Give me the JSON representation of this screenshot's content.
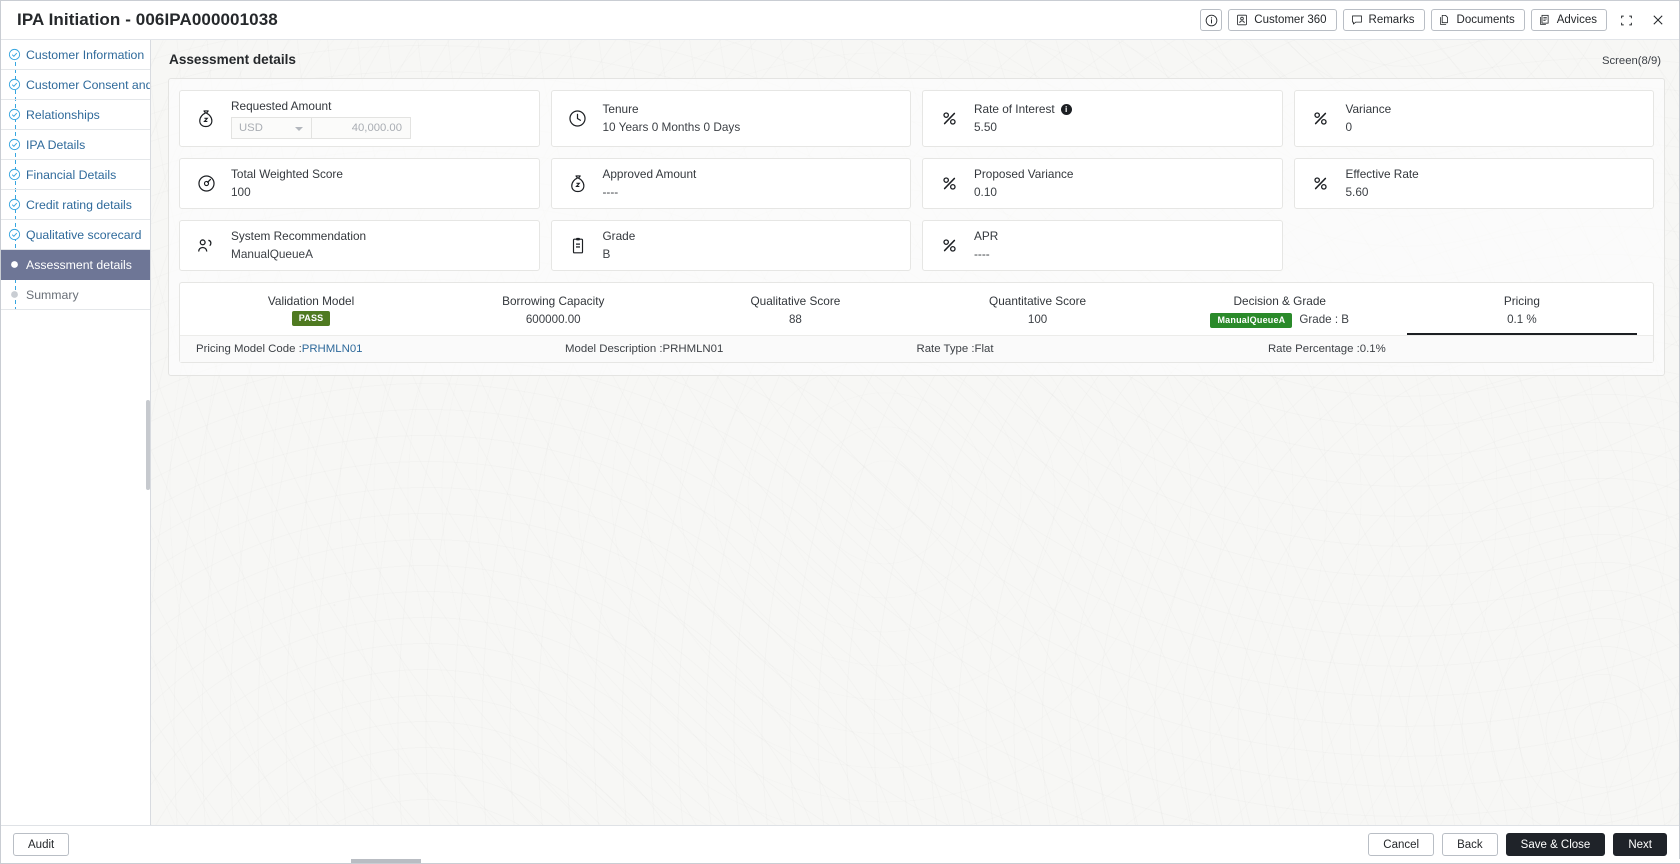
{
  "titlebar": {
    "title": "IPA Initiation - 006IPA000001038",
    "info_icon": "info-circle-icon",
    "buttons": [
      {
        "label": "Customer 360",
        "icon": "user-card-icon"
      },
      {
        "label": "Remarks",
        "icon": "speech-bubble-icon"
      },
      {
        "label": "Documents",
        "icon": "documents-icon"
      },
      {
        "label": "Advices",
        "icon": "advice-document-icon"
      }
    ],
    "minimize_icon": "collapse-icon",
    "close_icon": "close-icon"
  },
  "sidebar": {
    "items": [
      {
        "label": "Customer Information",
        "state": "done"
      },
      {
        "label": "Customer Consent and",
        "state": "done",
        "truncated": "..."
      },
      {
        "label": "Relationships",
        "state": "done"
      },
      {
        "label": "IPA Details",
        "state": "done"
      },
      {
        "label": "Financial Details",
        "state": "done"
      },
      {
        "label": "Credit rating details",
        "state": "done"
      },
      {
        "label": "Qualitative scorecard",
        "state": "done"
      },
      {
        "label": "Assessment details",
        "state": "active"
      },
      {
        "label": "Summary",
        "state": "pending"
      }
    ]
  },
  "main": {
    "section_title": "Assessment details",
    "screen_count": "Screen(8/9)",
    "cards": [
      {
        "label": "Requested Amount",
        "icon": "money-bag-icon",
        "type": "amount",
        "currency": "USD",
        "amount": "40,000.00"
      },
      {
        "label": "Tenure",
        "icon": "clock-icon",
        "value": "10 Years 0 Months 0 Days"
      },
      {
        "label": "Rate of Interest",
        "icon": "percent-icon",
        "value": "5.50",
        "info": "i"
      },
      {
        "label": "Variance",
        "icon": "percent-icon",
        "value": "0"
      },
      {
        "label": "Total Weighted Score",
        "icon": "gauge-icon",
        "value": "100"
      },
      {
        "label": "Approved Amount",
        "icon": "money-bag-icon",
        "value": "----"
      },
      {
        "label": "Proposed Variance",
        "icon": "percent-icon",
        "value": "0.10"
      },
      {
        "label": "Effective Rate",
        "icon": "percent-icon",
        "value": "5.60"
      },
      {
        "label": "System Recommendation",
        "icon": "users-icon",
        "value": "ManualQueueA"
      },
      {
        "label": "Grade",
        "icon": "clipboard-icon",
        "value": "B"
      },
      {
        "label": "APR",
        "icon": "percent-icon",
        "value": "----"
      }
    ],
    "summary": {
      "columns": [
        {
          "head": "Validation Model",
          "badge": "PASS",
          "value": ""
        },
        {
          "head": "Borrowing Capacity",
          "value": "600000.00"
        },
        {
          "head": "Qualitative Score",
          "value": "88"
        },
        {
          "head": "Quantitative Score",
          "value": "100"
        },
        {
          "head": "Decision & Grade",
          "badge": "ManualQueueA",
          "value": "Grade : B"
        },
        {
          "head": "Pricing",
          "value": "0.1 %",
          "selected": true
        }
      ],
      "details": [
        "Pricing Model Code :",
        "PRHMLN01",
        "Model Description :PRHMLN01",
        "Rate Type :Flat",
        "Rate Percentage :0.1%"
      ]
    }
  },
  "footer": {
    "audit": "Audit",
    "cancel": "Cancel",
    "back": "Back",
    "save_close": "Save & Close",
    "next": "Next"
  },
  "colors": {
    "accent_blue": "#2f6a9b",
    "active_nav": "#6e7696",
    "pass_green": "#4f7a21",
    "decision_green": "#2a8a2a",
    "dark_button": "#1f2329"
  }
}
